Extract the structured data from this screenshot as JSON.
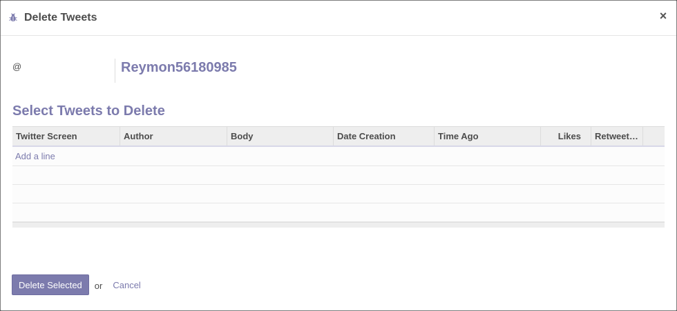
{
  "dialog": {
    "title": "Delete Tweets",
    "close_glyph": "×",
    "title_icon": "bug-icon"
  },
  "form": {
    "field_label": "@",
    "field_value": "Reymon56180985"
  },
  "section": {
    "title": "Select Tweets to Delete"
  },
  "grid": {
    "columns": [
      {
        "label": "Twitter Screen"
      },
      {
        "label": "Author"
      },
      {
        "label": "Body"
      },
      {
        "label": "Date Creation"
      },
      {
        "label": "Time Ago"
      },
      {
        "label": "Likes"
      },
      {
        "label": "Retweet…"
      },
      {
        "label": ""
      }
    ],
    "add_line_label": "Add a line",
    "empty_rows": 3
  },
  "footer": {
    "primary_label": "Delete Selected",
    "or_text": "or",
    "cancel_label": "Cancel"
  },
  "colors": {
    "accent": "#7c7bad",
    "text": "#4c4c4c",
    "grid_header_bg": "#eeeeee"
  }
}
